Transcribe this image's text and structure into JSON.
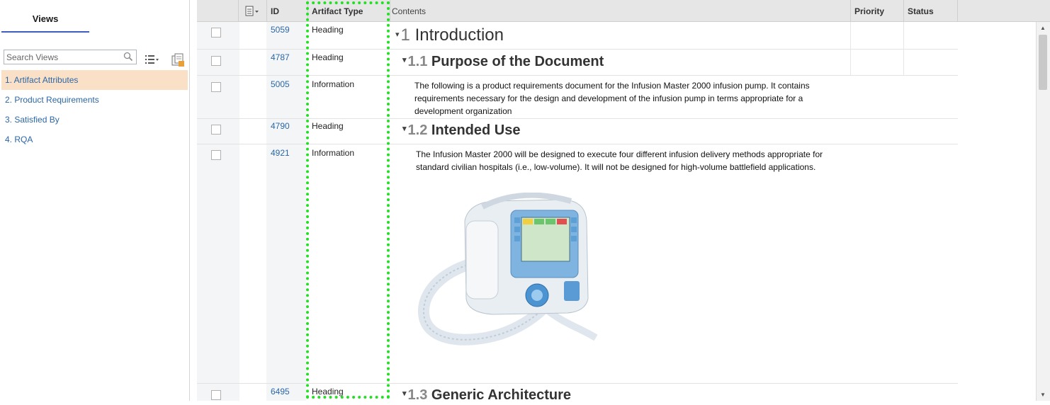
{
  "left": {
    "views_tab": "Views",
    "search_placeholder": "Search Views",
    "views": [
      {
        "label": "1. Artifact Attributes"
      },
      {
        "label": "2. Product Requirements"
      },
      {
        "label": "3. Satisfied By"
      },
      {
        "label": "4. RQA"
      }
    ]
  },
  "grid": {
    "headers": {
      "id": "ID",
      "artifact_type": "Artifact Type",
      "contents": "Contents",
      "priority": "Priority",
      "status": "Status"
    },
    "rows": [
      {
        "id": "5059",
        "type": "Heading",
        "num": "1",
        "title": "Introduction"
      },
      {
        "id": "4787",
        "type": "Heading",
        "num": "1.1",
        "title": "Purpose of the Document"
      },
      {
        "id": "5005",
        "type": "Information",
        "text": "The following is a product requirements document for the Infusion Master 2000 infusion pump. It contains requirements necessary for the design and development of the infusion pump in terms appropriate for a development organization"
      },
      {
        "id": "4790",
        "type": "Heading",
        "num": "1.2",
        "title": "Intended Use"
      },
      {
        "id": "4921",
        "type": "Information",
        "text": "The Infusion Master 2000 will be designed to execute four different infusion delivery methods appropriate for standard civilian hospitals (i.e., low-volume). It will not be designed for high-volume battlefield applications."
      },
      {
        "id": "6495",
        "type": "Heading",
        "num": "1.3",
        "title": "Generic Architecture"
      }
    ]
  },
  "colors": {
    "highlight": "#22e022",
    "link": "#2b67a6",
    "active_view": "#f9e0c7"
  }
}
